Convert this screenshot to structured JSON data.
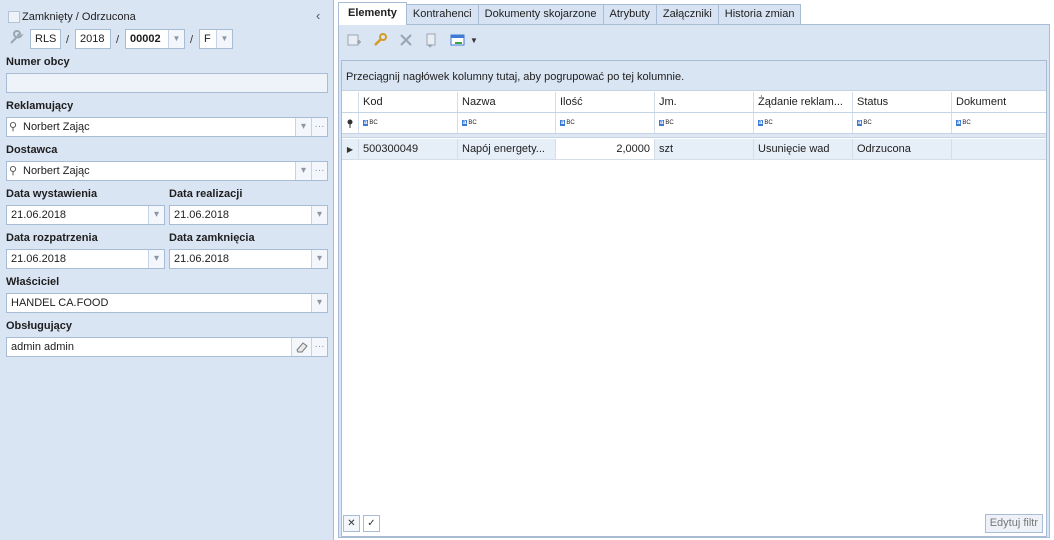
{
  "header": {
    "status_label": "Zamknięty / Odrzucona",
    "doc_series": "RLS",
    "doc_year": "2018",
    "doc_number": "00002",
    "doc_suffix": "F"
  },
  "form": {
    "numer_obcy_label": "Numer obcy",
    "numer_obcy_value": "",
    "reklamujacy_label": "Reklamujący",
    "reklamujacy_value": "Norbert Zając",
    "dostawca_label": "Dostawca",
    "dostawca_value": "Norbert Zając",
    "data_wystawienia_label": "Data wystawienia",
    "data_wystawienia_value": "21.06.2018",
    "data_realizacji_label": "Data realizacji",
    "data_realizacji_value": "21.06.2018",
    "data_rozpatrzenia_label": "Data rozpatrzenia",
    "data_rozpatrzenia_value": "21.06.2018",
    "data_zamkniecia_label": "Data zamknięcia",
    "data_zamkniecia_value": "21.06.2018",
    "wlasciciel_label": "Właściciel",
    "wlasciciel_value": "HANDEL CA.FOOD",
    "obslugujacy_label": "Obsługujący",
    "obslugujacy_value": "admin admin"
  },
  "tabs": [
    {
      "label": "Elementy",
      "active": true
    },
    {
      "label": "Kontrahenci"
    },
    {
      "label": "Dokumenty skojarzone"
    },
    {
      "label": "Atrybuty"
    },
    {
      "label": "Załączniki"
    },
    {
      "label": "Historia zmian"
    }
  ],
  "grid": {
    "group_hint": "Przeciągnij nagłówek kolumny tutaj, aby pogrupować po tej kolumnie.",
    "columns": [
      "Kod",
      "Nazwa",
      "Ilość",
      "Jm.",
      "Żądanie reklam...",
      "Status",
      "Dokument"
    ],
    "rows": [
      {
        "kod": "500300049",
        "nazwa": "Napój energety...",
        "ilosc": "2,0000",
        "jm": "szt",
        "zadanie": "Usunięcie wad",
        "status": "Odrzucona",
        "dokument": ""
      }
    ]
  },
  "footer": {
    "edit_filter_label": "Edytuj filtr"
  }
}
